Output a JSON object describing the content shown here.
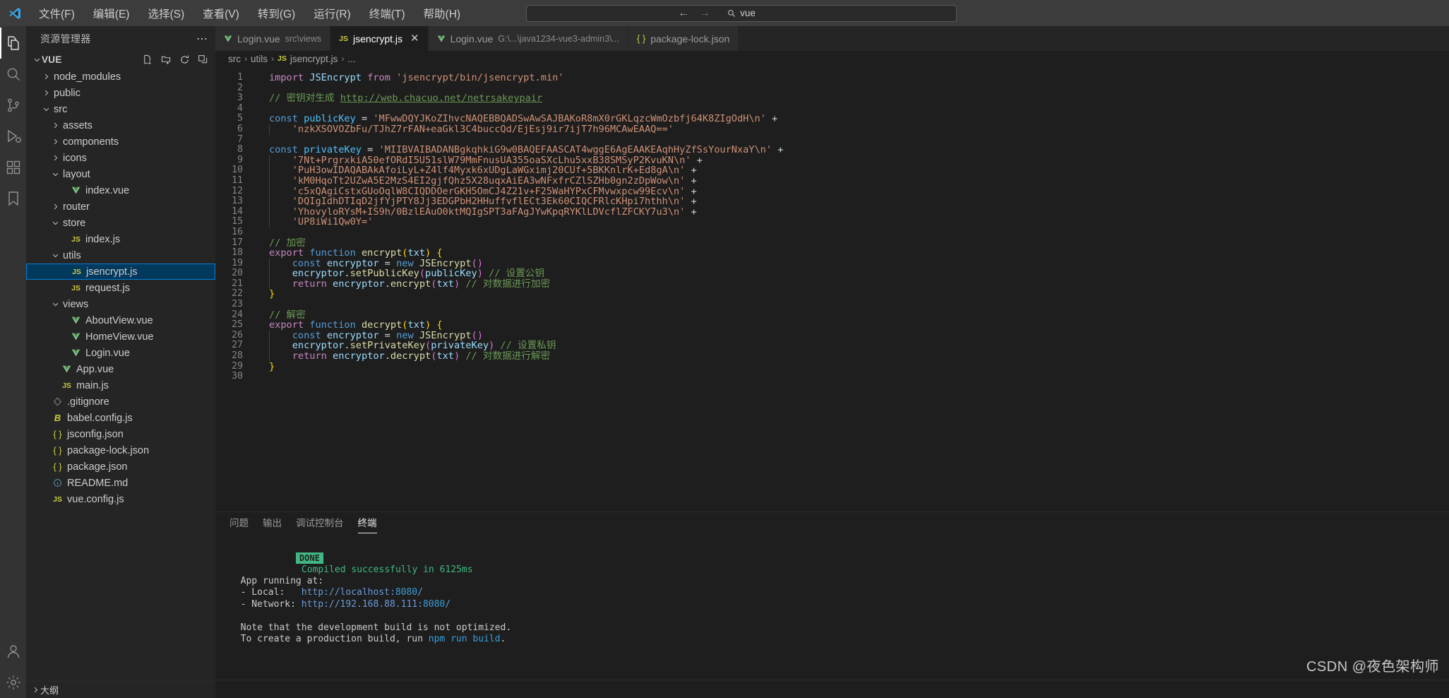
{
  "titlebar": {
    "logo": "vscode-logo",
    "menus": [
      {
        "label": "文件(F)",
        "name": "menu-file"
      },
      {
        "label": "编辑(E)",
        "name": "menu-edit"
      },
      {
        "label": "选择(S)",
        "name": "menu-selection"
      },
      {
        "label": "查看(V)",
        "name": "menu-view"
      },
      {
        "label": "转到(G)",
        "name": "menu-go"
      },
      {
        "label": "运行(R)",
        "name": "menu-run"
      },
      {
        "label": "终端(T)",
        "name": "menu-terminal"
      },
      {
        "label": "帮助(H)",
        "name": "menu-help"
      }
    ],
    "nav_back": "←",
    "nav_forward": "→",
    "search_value": "vue",
    "search_icon": "search-icon"
  },
  "activitybar": {
    "items": [
      {
        "name": "explorer",
        "icon": "files-icon",
        "active": true
      },
      {
        "name": "search",
        "icon": "search-icon",
        "active": false
      },
      {
        "name": "source-control",
        "icon": "source-control-icon",
        "active": false
      },
      {
        "name": "run-and-debug",
        "icon": "debug-icon",
        "active": false
      },
      {
        "name": "extensions",
        "icon": "extensions-icon",
        "active": false
      },
      {
        "name": "bookmarks",
        "icon": "bookmark-icon",
        "active": false
      }
    ],
    "bottom": [
      {
        "name": "accounts",
        "icon": "account-icon"
      },
      {
        "name": "settings",
        "icon": "gear-icon"
      }
    ]
  },
  "sidebar": {
    "title": "资源管理器",
    "more_actions": "⋯",
    "root": {
      "label": "VUE",
      "expanded": true,
      "actions": [
        "new-file-icon",
        "new-folder-icon",
        "refresh-icon",
        "collapse-all-icon"
      ]
    },
    "tree": [
      {
        "label": "node_modules",
        "type": "folder",
        "expanded": false,
        "indent": 1
      },
      {
        "label": "public",
        "type": "folder",
        "expanded": false,
        "indent": 1
      },
      {
        "label": "src",
        "type": "folder",
        "expanded": true,
        "indent": 1
      },
      {
        "label": "assets",
        "type": "folder",
        "expanded": false,
        "indent": 2
      },
      {
        "label": "components",
        "type": "folder",
        "expanded": false,
        "indent": 2
      },
      {
        "label": "icons",
        "type": "folder",
        "expanded": false,
        "indent": 2
      },
      {
        "label": "layout",
        "type": "folder",
        "expanded": true,
        "indent": 2
      },
      {
        "label": "index.vue",
        "type": "vue",
        "indent": 3
      },
      {
        "label": "router",
        "type": "folder",
        "expanded": false,
        "indent": 2
      },
      {
        "label": "store",
        "type": "folder",
        "expanded": true,
        "indent": 2
      },
      {
        "label": "index.js",
        "type": "js",
        "indent": 3
      },
      {
        "label": "utils",
        "type": "folder",
        "expanded": true,
        "indent": 2
      },
      {
        "label": "jsencrypt.js",
        "type": "js",
        "indent": 3,
        "selected": true
      },
      {
        "label": "request.js",
        "type": "js",
        "indent": 3
      },
      {
        "label": "views",
        "type": "folder",
        "expanded": true,
        "indent": 2
      },
      {
        "label": "AboutView.vue",
        "type": "vue",
        "indent": 3
      },
      {
        "label": "HomeView.vue",
        "type": "vue",
        "indent": 3
      },
      {
        "label": "Login.vue",
        "type": "vue",
        "indent": 3
      },
      {
        "label": "App.vue",
        "type": "vue",
        "indent": 2
      },
      {
        "label": "main.js",
        "type": "js",
        "indent": 2
      },
      {
        "label": ".gitignore",
        "type": "git",
        "indent": 1
      },
      {
        "label": "babel.config.js",
        "type": "babel",
        "indent": 1
      },
      {
        "label": "jsconfig.json",
        "type": "json",
        "indent": 1
      },
      {
        "label": "package-lock.json",
        "type": "json",
        "indent": 1
      },
      {
        "label": "package.json",
        "type": "json",
        "indent": 1
      },
      {
        "label": "README.md",
        "type": "md",
        "indent": 1
      },
      {
        "label": "vue.config.js",
        "type": "js",
        "indent": 1
      }
    ],
    "footer": {
      "label": "大纲",
      "expanded": false
    }
  },
  "editor": {
    "tabs": [
      {
        "label": "Login.vue",
        "path": "src\\views",
        "icon": "vue-icon",
        "active": false,
        "closable": false
      },
      {
        "label": "jsencrypt.js",
        "path": "",
        "icon": "js-icon",
        "active": true,
        "closable": true
      },
      {
        "label": "Login.vue",
        "path": "G:\\...\\java1234-vue3-admin3\\...",
        "icon": "vue-icon",
        "active": false,
        "closable": false
      },
      {
        "label": "package-lock.json",
        "path": "",
        "icon": "json-icon",
        "active": false,
        "closable": false
      }
    ],
    "breadcrumb": [
      "src",
      "utils",
      "jsencrypt.js",
      "..."
    ],
    "filename": "jsencrypt.js",
    "line_count": 30,
    "lines": [
      {
        "n": 1,
        "tokens": [
          [
            "t-kw2",
            "import "
          ],
          [
            "t-var",
            "JSEncrypt"
          ],
          [
            "t-op",
            " "
          ],
          [
            "t-kw2",
            "from"
          ],
          [
            "t-op",
            " "
          ],
          [
            "t-str",
            "'jsencrypt/bin/jsencrypt.min'"
          ]
        ]
      },
      {
        "n": 2,
        "tokens": []
      },
      {
        "n": 3,
        "tokens": [
          [
            "t-cmt",
            "// 密钥对生成 "
          ],
          [
            "t-lnk",
            "http://web.chacuo.net/netrsakeypair"
          ]
        ]
      },
      {
        "n": 4,
        "tokens": []
      },
      {
        "n": 5,
        "tokens": [
          [
            "t-kw",
            "const "
          ],
          [
            "t-type",
            "publicKey"
          ],
          [
            "t-op",
            " = "
          ],
          [
            "t-str",
            "'MFwwDQYJKoZIhvcNAQEBBQADSwAwSAJBAKoR8mX0rGKLqzcWmOzbfj64K8ZIgOdH\\n'"
          ],
          [
            "t-op",
            " +"
          ]
        ]
      },
      {
        "n": 6,
        "indent": 1,
        "tokens": [
          [
            "t-str",
            "'nzkXSOVOZbFu/TJhZ7rFAN+eaGkl3C4buccQd/EjEsj9ir7ijT7h96MCAwEAAQ=='"
          ]
        ]
      },
      {
        "n": 7,
        "tokens": []
      },
      {
        "n": 8,
        "tokens": [
          [
            "t-kw",
            "const "
          ],
          [
            "t-type",
            "privateKey"
          ],
          [
            "t-op",
            " = "
          ],
          [
            "t-str",
            "'MIIBVAIBADANBgkqhkiG9w0BAQEFAASCAT4wggE6AgEAAKEAqhHyZfSsYourNxaY\\n'"
          ],
          [
            "t-op",
            " +"
          ]
        ]
      },
      {
        "n": 9,
        "indent": 1,
        "tokens": [
          [
            "t-str",
            "'7Nt+PrgrxkiA50efORdI5U51slW79MmFnusUA355oaSXcLhu5xxB38SMSyP2KvuKN\\n'"
          ],
          [
            "t-op",
            " +"
          ]
        ]
      },
      {
        "n": 10,
        "indent": 1,
        "tokens": [
          [
            "t-str",
            "'PuH3owIDAQABAkAfoiLyL+Z4lf4Myxk6xUDgLaWGximj20CUf+5BKKnlrK+Ed8gA\\n'"
          ],
          [
            "t-op",
            " +"
          ]
        ]
      },
      {
        "n": 11,
        "indent": 1,
        "tokens": [
          [
            "t-str",
            "'kM0HqoTt2UZwA5E2MzS4EI2gjfQhz5X28uqxAiEA3wNFxfrCZlSZHb0gn2zDpWow\\n'"
          ],
          [
            "t-op",
            " +"
          ]
        ]
      },
      {
        "n": 12,
        "indent": 1,
        "tokens": [
          [
            "t-str",
            "'c5xQAgiCstxGUoOqlW8CIQDDOerGKH5OmCJ4Z21v+F25WaHYPxCFMvwxpcw99Ecv\\n'"
          ],
          [
            "t-op",
            " +"
          ]
        ]
      },
      {
        "n": 13,
        "indent": 1,
        "tokens": [
          [
            "t-str",
            "'DQIgIdhDTIqD2jfYjPTY8Jj3EDGPbH2HHuffvflECt3Ek60CIQCFRlcKHpi7hthh\\n'"
          ],
          [
            "t-op",
            " +"
          ]
        ]
      },
      {
        "n": 14,
        "indent": 1,
        "tokens": [
          [
            "t-str",
            "'YhovyloRYsM+IS9h/0BzlEAuO0ktMQIgSPT3aFAgJYwKpqRYKlLDVcflZFCKY7u3\\n'"
          ],
          [
            "t-op",
            " +"
          ]
        ]
      },
      {
        "n": 15,
        "indent": 1,
        "tokens": [
          [
            "t-str",
            "'UP8iWi1Qw0Y='"
          ]
        ]
      },
      {
        "n": 16,
        "tokens": []
      },
      {
        "n": 17,
        "tokens": [
          [
            "t-cmt",
            "// 加密"
          ]
        ]
      },
      {
        "n": 18,
        "tokens": [
          [
            "t-kw2",
            "export "
          ],
          [
            "t-kw",
            "function "
          ],
          [
            "t-fn",
            "encrypt"
          ],
          [
            "t-br",
            "("
          ],
          [
            "t-var",
            "txt"
          ],
          [
            "t-br",
            ")"
          ],
          [
            "t-op",
            " "
          ],
          [
            "t-br",
            "{"
          ]
        ]
      },
      {
        "n": 19,
        "indent": 1,
        "tokens": [
          [
            "t-kw",
            "const "
          ],
          [
            "t-var",
            "encryptor"
          ],
          [
            "t-op",
            " = "
          ],
          [
            "t-kw",
            "new "
          ],
          [
            "t-fn",
            "JSEncrypt"
          ],
          [
            "t-br2",
            "()"
          ]
        ]
      },
      {
        "n": 20,
        "indent": 1,
        "tokens": [
          [
            "t-var",
            "encryptor"
          ],
          [
            "t-op",
            "."
          ],
          [
            "t-fn",
            "setPublicKey"
          ],
          [
            "t-br2",
            "("
          ],
          [
            "t-var",
            "publicKey"
          ],
          [
            "t-br2",
            ")"
          ],
          [
            "t-op",
            " "
          ],
          [
            "t-cmt",
            "// 设置公钥"
          ]
        ]
      },
      {
        "n": 21,
        "indent": 1,
        "tokens": [
          [
            "t-kw2",
            "return "
          ],
          [
            "t-var",
            "encryptor"
          ],
          [
            "t-op",
            "."
          ],
          [
            "t-fn",
            "encrypt"
          ],
          [
            "t-br2",
            "("
          ],
          [
            "t-var",
            "txt"
          ],
          [
            "t-br2",
            ")"
          ],
          [
            "t-op",
            " "
          ],
          [
            "t-cmt",
            "// 对数据进行加密"
          ]
        ]
      },
      {
        "n": 22,
        "tokens": [
          [
            "t-br",
            "}"
          ]
        ]
      },
      {
        "n": 23,
        "tokens": []
      },
      {
        "n": 24,
        "tokens": [
          [
            "t-cmt",
            "// 解密"
          ]
        ]
      },
      {
        "n": 25,
        "tokens": [
          [
            "t-kw2",
            "export "
          ],
          [
            "t-kw",
            "function "
          ],
          [
            "t-fn",
            "decrypt"
          ],
          [
            "t-br",
            "("
          ],
          [
            "t-var",
            "txt"
          ],
          [
            "t-br",
            ")"
          ],
          [
            "t-op",
            " "
          ],
          [
            "t-br",
            "{"
          ]
        ]
      },
      {
        "n": 26,
        "indent": 1,
        "tokens": [
          [
            "t-kw",
            "const "
          ],
          [
            "t-var",
            "encryptor"
          ],
          [
            "t-op",
            " = "
          ],
          [
            "t-kw",
            "new "
          ],
          [
            "t-fn",
            "JSEncrypt"
          ],
          [
            "t-br2",
            "()"
          ]
        ]
      },
      {
        "n": 27,
        "indent": 1,
        "tokens": [
          [
            "t-var",
            "encryptor"
          ],
          [
            "t-op",
            "."
          ],
          [
            "t-fn",
            "setPrivateKey"
          ],
          [
            "t-br2",
            "("
          ],
          [
            "t-var",
            "privateKey"
          ],
          [
            "t-br2",
            ")"
          ],
          [
            "t-op",
            " "
          ],
          [
            "t-cmt",
            "// 设置私钥"
          ]
        ]
      },
      {
        "n": 28,
        "indent": 1,
        "tokens": [
          [
            "t-kw2",
            "return "
          ],
          [
            "t-var",
            "encryptor"
          ],
          [
            "t-op",
            "."
          ],
          [
            "t-fn",
            "decrypt"
          ],
          [
            "t-br2",
            "("
          ],
          [
            "t-var",
            "txt"
          ],
          [
            "t-br2",
            ")"
          ],
          [
            "t-op",
            " "
          ],
          [
            "t-cmt",
            "// 对数据进行解密"
          ]
        ]
      },
      {
        "n": 29,
        "tokens": [
          [
            "t-br",
            "}"
          ]
        ]
      },
      {
        "n": 30,
        "tokens": []
      }
    ]
  },
  "panel": {
    "tabs": [
      {
        "label": "问题",
        "name": "tab-problems",
        "active": false
      },
      {
        "label": "输出",
        "name": "tab-output",
        "active": false
      },
      {
        "label": "调试控制台",
        "name": "tab-debug-console",
        "active": false
      },
      {
        "label": "终端",
        "name": "tab-terminal",
        "active": true
      }
    ],
    "terminal": {
      "badge": "DONE",
      "compiled_text": "Compiled successfully in 6125ms",
      "lines": [
        {
          "type": "blank"
        },
        {
          "type": "blank"
        },
        {
          "type": "plain",
          "text": "  App running at:"
        },
        {
          "type": "link",
          "prefix": "  - Local:   ",
          "url": "http://localhost:",
          "port": "8080",
          "suffix": "/"
        },
        {
          "type": "link",
          "prefix": "  - Network: ",
          "url": "http://192.168.88.111:",
          "port": "8080",
          "suffix": "/"
        },
        {
          "type": "blank"
        },
        {
          "type": "plain",
          "text": "  Note that the development build is not optimized."
        },
        {
          "type": "cmd",
          "prefix": "  To create a production build, run ",
          "cmd": "npm run build",
          "suffix": "."
        }
      ]
    }
  },
  "statusbar": {
    "outline_label": "大纲"
  },
  "watermark": "CSDN @夜色架构师"
}
